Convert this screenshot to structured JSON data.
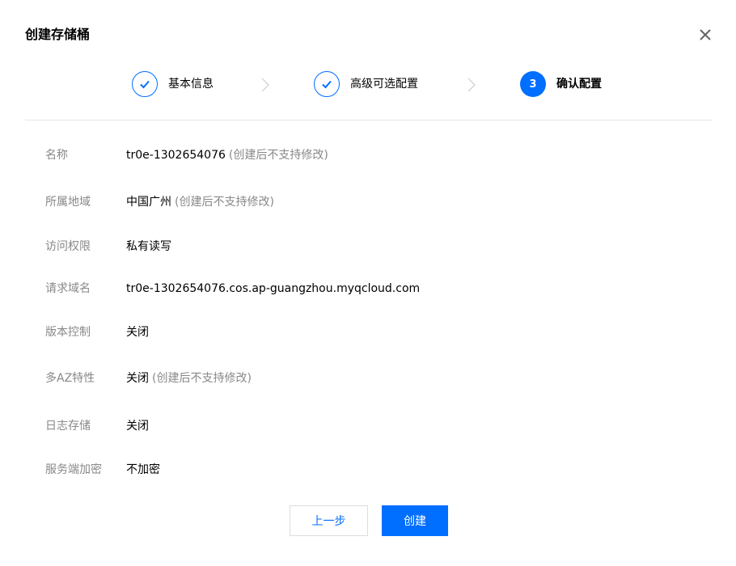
{
  "dialog": {
    "title": "创建存储桶"
  },
  "steps": [
    {
      "label": "基本信息",
      "status": "done"
    },
    {
      "label": "高级可选配置",
      "status": "done"
    },
    {
      "number": "3",
      "label": "确认配置",
      "status": "active"
    }
  ],
  "details": {
    "name": {
      "label": "名称",
      "value": "tr0e-1302654076",
      "note": "(创建后不支持修改)"
    },
    "region": {
      "label": "所属地域",
      "value": "中国广州",
      "note": "(创建后不支持修改)"
    },
    "access": {
      "label": "访问权限",
      "value": "私有读写"
    },
    "domain": {
      "label": "请求域名",
      "value": "tr0e-1302654076.cos.ap-guangzhou.myqcloud.com"
    },
    "versioning": {
      "label": "版本控制",
      "value": "关闭"
    },
    "multi_az": {
      "label": "多AZ特性",
      "value": "关闭",
      "note": "(创建后不支持修改)"
    },
    "logging": {
      "label": "日志存储",
      "value": "关闭"
    },
    "encryption": {
      "label": "服务端加密",
      "value": "不加密"
    }
  },
  "footer": {
    "prev_label": "上一步",
    "create_label": "创建"
  },
  "colors": {
    "accent": "#006eff",
    "label": "#888888",
    "divider": "#e6e6e6"
  },
  "icons": {
    "close": "close-icon",
    "check": "check-icon",
    "separator": "chevron-right-icon"
  }
}
